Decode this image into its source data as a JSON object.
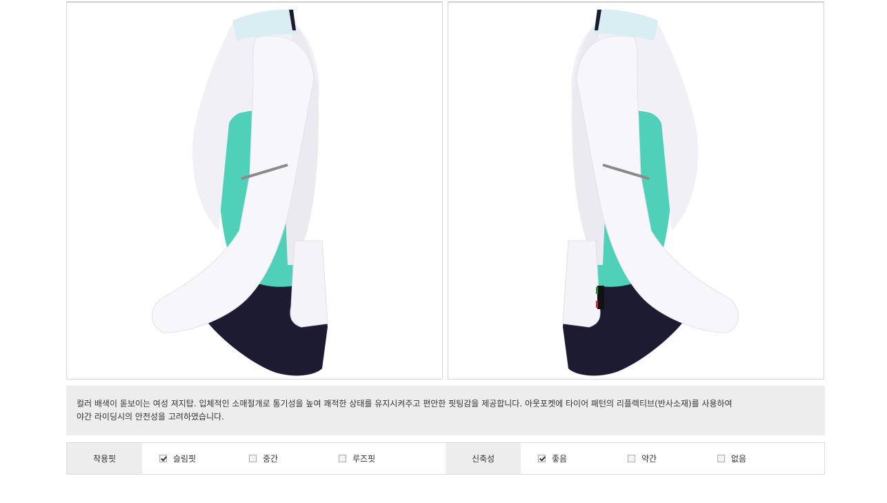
{
  "images": {
    "left_alt": "",
    "right_alt": ""
  },
  "description": {
    "line1": "컬러 배색이 돋보이는 여성 져지탑. 입체적인 소매절개로 통기성을 높여 쾌적한 상태를 유지시켜주고 편안한 핏팅감을 제공합니다. 아웃포켓에 타이어 패턴의 리플렉티브(반사소재)를 사용하여",
    "line2": "야간 라이딩시의 안전성을 고려하였습니다."
  },
  "specs": {
    "fit": {
      "label": "착용핏",
      "options": [
        {
          "label": "슬림핏",
          "checked": true
        },
        {
          "label": "중간",
          "checked": false
        },
        {
          "label": "루즈핏",
          "checked": false
        }
      ]
    },
    "stretch": {
      "label": "신축성",
      "options": [
        {
          "label": "좋음",
          "checked": true
        },
        {
          "label": "약간",
          "checked": false
        },
        {
          "label": "없음",
          "checked": false
        }
      ]
    }
  },
  "colors": {
    "jersey_white": "#f1f0f6",
    "jersey_mint": "#4fd0b8",
    "jersey_navy": "#1c1b31",
    "collar": "#d9eef2",
    "reflective": "#8a8a8a",
    "panel_bg": "#ededed"
  }
}
